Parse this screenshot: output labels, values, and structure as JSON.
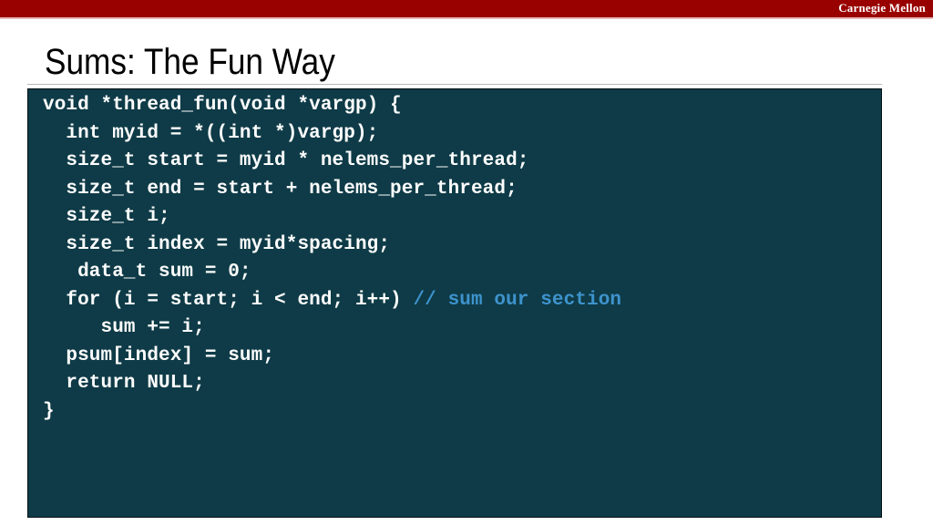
{
  "banner": {
    "brand": "Carnegie Mellon",
    "bg_color": "#990000",
    "underline_color": "#e8b8b8",
    "brand_color": "#ffffff"
  },
  "slide": {
    "title": "Sums: The Fun Way",
    "title_color": "#000000",
    "background_color": "#ffffff",
    "rule_color": "#b9b9b9"
  },
  "code_block": {
    "background_color": "#0e3b47",
    "border_color": "#050f13",
    "text_color": "#fdfdfd",
    "comment_color": "#3e93cd",
    "language": "c",
    "lines": [
      {
        "code": "void *thread_fun(void *vargp) {",
        "comment": ""
      },
      {
        "code": "  int myid = *((int *)vargp);",
        "comment": ""
      },
      {
        "code": "  size_t start = myid * nelems_per_thread;",
        "comment": ""
      },
      {
        "code": "  size_t end = start + nelems_per_thread;",
        "comment": ""
      },
      {
        "code": "  size_t i;",
        "comment": ""
      },
      {
        "code": "  size_t index = myid*spacing;",
        "comment": ""
      },
      {
        "code": "   data_t sum = 0;",
        "comment": ""
      },
      {
        "code": "  for (i = start; i < end; i++) ",
        "comment": "// sum our section"
      },
      {
        "code": "     sum += i;",
        "comment": ""
      },
      {
        "code": "  psum[index] = sum;",
        "comment": ""
      },
      {
        "code": "  return NULL;",
        "comment": ""
      },
      {
        "code": "}",
        "comment": ""
      }
    ]
  }
}
